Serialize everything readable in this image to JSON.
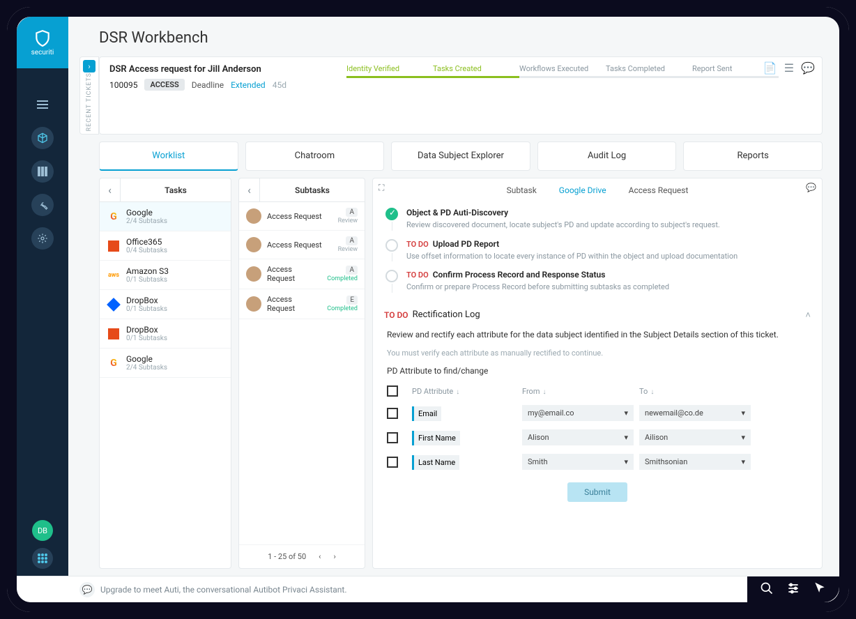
{
  "brand": "securiti",
  "page_title": "DSR Workbench",
  "recent_label": "RECENT TICKETS",
  "user_avatar": "DB",
  "ticket": {
    "title": "DSR Access request for Jill Anderson",
    "id": "100095",
    "badge": "ACCESS",
    "deadline_label": "Deadline",
    "deadline_state": "Extended",
    "deadline_days": "45d",
    "steps": [
      {
        "label": "Identity Verified",
        "done": true
      },
      {
        "label": "Tasks Created",
        "done": true
      },
      {
        "label": "Workflows Executed",
        "done": false
      },
      {
        "label": "Tasks Completed",
        "done": false
      },
      {
        "label": "Report Sent",
        "done": false
      }
    ]
  },
  "tabs": [
    "Worklist",
    "Chatroom",
    "Data Subject Explorer",
    "Audit Log",
    "Reports"
  ],
  "tasks_title": "Tasks",
  "tasks": [
    {
      "name": "Google",
      "sub": "2/4 Subtasks",
      "icon": "google"
    },
    {
      "name": "Office365",
      "sub": "0/4 Subtasks",
      "icon": "office"
    },
    {
      "name": "Amazon S3",
      "sub": "0/1 Subtasks",
      "icon": "aws"
    },
    {
      "name": "DropBox",
      "sub": "0/1 Subtasks",
      "icon": "dropbox"
    },
    {
      "name": "DropBox",
      "sub": "0/1 Subtasks",
      "icon": "office"
    },
    {
      "name": "Google",
      "sub": "2/4 Subtasks",
      "icon": "google"
    }
  ],
  "subtasks_title": "Subtasks",
  "subtasks": [
    {
      "label": "Access Request",
      "chip": "A",
      "status": "Review",
      "done": false
    },
    {
      "label": "Access Request",
      "chip": "A",
      "status": "Review",
      "done": false
    },
    {
      "label": "Access Request",
      "chip": "A",
      "status": "Completed",
      "done": true
    },
    {
      "label": "Access Request",
      "chip": "E",
      "status": "Completed",
      "done": true
    }
  ],
  "pager": "1 - 25 of 50",
  "detail": {
    "crumbs": {
      "subtask": "Subtask",
      "gd": "Google Drive",
      "ar": "Access Request"
    },
    "steps": [
      {
        "done": true,
        "todo": "",
        "title": "Object & PD Auti-Discovery",
        "desc": "Review discovered document, locate subject's PD and update according to subject's request."
      },
      {
        "done": false,
        "todo": "TO DO",
        "title": "Upload PD Report",
        "desc": "Use offset information to locate every instance of PD within the object and upload documentation"
      },
      {
        "done": false,
        "todo": "TO DO",
        "title": "Confirm Process Record and Response Status",
        "desc": "Confirm or prepare Process Record before submitting subtasks as completed"
      }
    ],
    "rect": {
      "todo": "TO DO",
      "title": "Rectification Log",
      "help": "Review and rectify each attribute for the data subject identified in the Subject Details section of this ticket.",
      "hint": "You must verify each attribute as manually rectified to continue.",
      "subhead": "PD Attribute to find/change",
      "cols": {
        "attr": "PD Attribute",
        "from": "From",
        "to": "To"
      },
      "rows": [
        {
          "attr": "Email",
          "from": "my@email.co",
          "to": "newemail@co.de"
        },
        {
          "attr": "First Name",
          "from": "Alison",
          "to": "Ailison"
        },
        {
          "attr": "Last Name",
          "from": "Smith",
          "to": "Smithsonian"
        }
      ],
      "submit": "Submit"
    }
  },
  "upgrade_msg": "Upgrade to meet Auti, the conversational Autibot Privaci Assistant."
}
